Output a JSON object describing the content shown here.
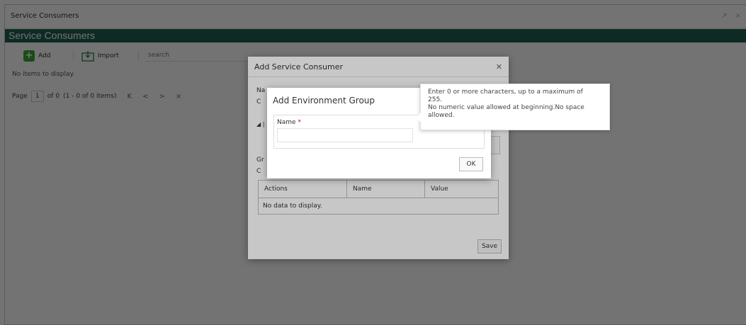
{
  "window": {
    "title": "Service Consumers",
    "controls": "↗ ×"
  },
  "header": {
    "title": "Service Consumers"
  },
  "toolbar": {
    "add_label": "Add",
    "import_label": "Import",
    "search_placeholder": "search"
  },
  "list": {
    "empty_text": "No items to display."
  },
  "pager": {
    "page_label": "Page",
    "page_value": "1",
    "of_text": "of 0",
    "range_text": "(1 - 0 of 0 items)",
    "first": "K",
    "prev": "<",
    "next": ">",
    "last": "×"
  },
  "dialog_main": {
    "title": "Add Service Consumer",
    "name_label_partial": "Na",
    "field_value_partial": "C",
    "section_partial": "◢ |",
    "group_label_partial": "Gr",
    "group_value_partial": "C",
    "table": {
      "headers": [
        "Actions",
        "Name",
        "Value"
      ],
      "empty_text": "No data to display."
    },
    "save_label": "Save"
  },
  "dialog_env": {
    "title": "Add Environment Group",
    "name_label": "Name",
    "required_mark": "*",
    "name_value": "",
    "ok_label": "OK"
  },
  "tooltip": {
    "lines": [
      "Enter 0 or more characters, up to a maximum of",
      "255.",
      "No numeric value allowed at beginning.No space",
      "allowed."
    ]
  },
  "colors": {
    "header_bg": "#1f5f52",
    "add_icon": "#3aa935",
    "required": "#cc0000"
  }
}
